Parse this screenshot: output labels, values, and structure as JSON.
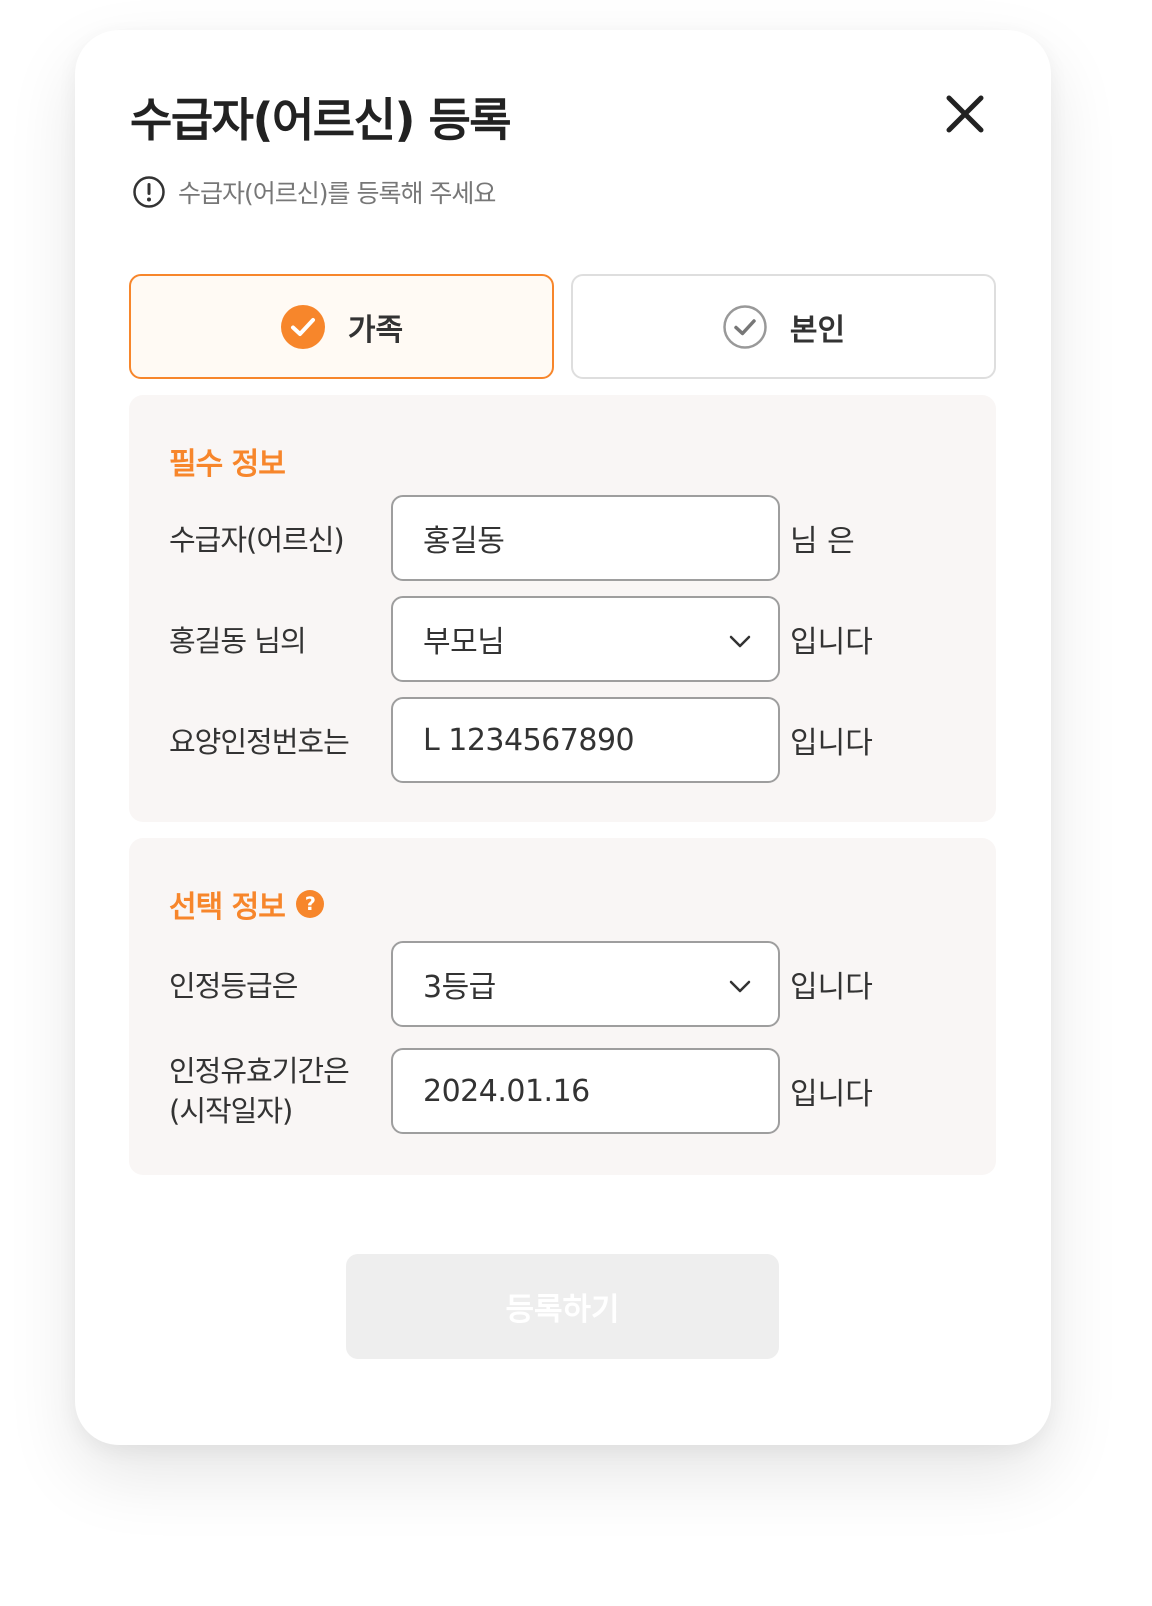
{
  "modal": {
    "title": "수급자(어르신) 등록",
    "notice": "수급자(어르신)를 등록해 주세요"
  },
  "segments": [
    {
      "label": "가족",
      "selected": true
    },
    {
      "label": "본인",
      "selected": false
    }
  ],
  "required": {
    "title": "필수 정보",
    "recipient": {
      "label": "수급자(어르신)",
      "value": "홍길동",
      "suffix": "님 은"
    },
    "relation": {
      "label": "홍길동 님의",
      "value": "부모님",
      "suffix": "입니다"
    },
    "cert_no": {
      "label": "요양인정번호는",
      "value": "L 1234567890",
      "suffix": "입니다"
    }
  },
  "optional": {
    "title": "선택 정보",
    "help_icon": "?",
    "grade": {
      "label": "인정등급은",
      "value": "3등급",
      "suffix": "입니다"
    },
    "valid_period": {
      "label_line1": "인정유효기간은",
      "label_line2": "(시작일자)",
      "value": "2024.01.16",
      "suffix": "입니다"
    }
  },
  "submit_label": "등록하기",
  "colors": {
    "accent": "#f7862b",
    "panel_bg": "#f9f6f5",
    "disabled_bg": "#eeeeee"
  }
}
